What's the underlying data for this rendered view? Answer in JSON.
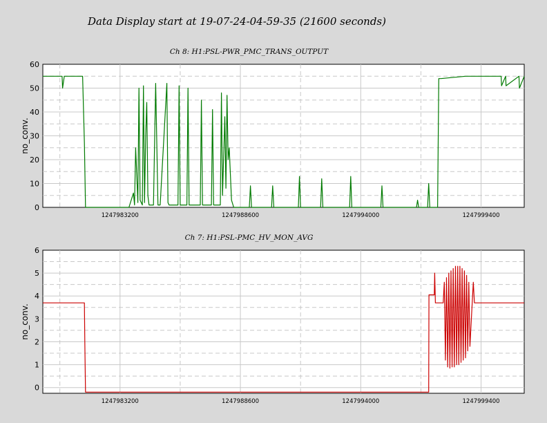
{
  "header": {
    "title": "Data Display start at 19-07-24-04-59-35 (21600 seconds)"
  },
  "colors": {
    "background": "#d9d9d9",
    "plot_bg": "#ffffff",
    "grid": "#c8c8c8",
    "series_ch8": "#007a00",
    "series_ch7": "#cc0000"
  },
  "chart_data": [
    {
      "type": "line",
      "title": "Ch 8: H1:PSL-PWR_PMC_TRANS_OUTPUT",
      "xlabel": "",
      "ylabel": "no_conv.",
      "xlim": [
        1247979735,
        1248001335
      ],
      "ylim": [
        0,
        60
      ],
      "yticks": [
        0,
        10,
        20,
        30,
        40,
        50,
        60
      ],
      "xticks": [
        1247983200,
        1247988600,
        1247994000,
        1247999400
      ],
      "xtick_labels": [
        "1247983200",
        "1247988600",
        "1247994000",
        "1247999400"
      ],
      "grid": true,
      "series": [
        {
          "color": "#007a00",
          "x": [
            1247979735,
            1247980600,
            1247980620,
            1247980700,
            1247981400,
            1247981520,
            1247981600,
            1247981650,
            1247983600,
            1247983800,
            1247983850,
            1247983900,
            1247984000,
            1247984050,
            1247984100,
            1247984200,
            1247984250,
            1247984300,
            1247984350,
            1247984400,
            1247984450,
            1247984500,
            1247984700,
            1247984800,
            1247984900,
            1247985000,
            1247985300,
            1247985350,
            1247985400,
            1247985800,
            1247985850,
            1247985900,
            1247986200,
            1247986250,
            1247986300,
            1247986800,
            1247986850,
            1247986900,
            1247987300,
            1247987350,
            1247987400,
            1247987700,
            1247987750,
            1247987800,
            1247987900,
            1247987950,
            1247988000,
            1247988050,
            1247988100,
            1247988200,
            1247988300,
            1247989000,
            1247989050,
            1247989100,
            1247990000,
            1247990050,
            1247990100,
            1247991200,
            1247991250,
            1247991300,
            1247992200,
            1247992250,
            1247992300,
            1247993500,
            1247993550,
            1247993600,
            1247994900,
            1247994950,
            1247995000,
            1247996500,
            1247996550,
            1247996600,
            1247997000,
            1247997050,
            1247997100,
            1247997450,
            1247997500,
            1247997600,
            1247998700,
            1247998750,
            1248000300,
            1248000320,
            1248000500,
            1248000520,
            1248001100,
            1248001120,
            1248001335
          ],
          "y": [
            55,
            55,
            50,
            55,
            55,
            55,
            27,
            0,
            0,
            6,
            1,
            25,
            2,
            50,
            3,
            1,
            51,
            2,
            30,
            44,
            5,
            1,
            1,
            52,
            1,
            1,
            52,
            2,
            1,
            1,
            51,
            1,
            1,
            50,
            1,
            1,
            45,
            1,
            1,
            41,
            1,
            1,
            48,
            5,
            38,
            8,
            47,
            20,
            25,
            3,
            0,
            0,
            9,
            0,
            0,
            9,
            0,
            0,
            13,
            0,
            0,
            12,
            0,
            0,
            13,
            0,
            0,
            9,
            0,
            0,
            3,
            0,
            0,
            10,
            0,
            0,
            54,
            54,
            55,
            55,
            55,
            51,
            55,
            51,
            55,
            50,
            55
          ]
        }
      ]
    },
    {
      "type": "line",
      "title": "Ch 7: H1:PSL-PMC_HV_MON_AVG",
      "xlabel": "",
      "ylabel": "no_conv.",
      "xlim": [
        1247979735,
        1248001335
      ],
      "ylim": [
        -0.25,
        6
      ],
      "yticks": [
        0,
        1,
        2,
        3,
        4,
        5,
        6
      ],
      "xticks": [
        1247983200,
        1247988600,
        1247994000,
        1247999400
      ],
      "xtick_labels": [
        "1247983200",
        "1247988600",
        "1247994000",
        "1247999400"
      ],
      "grid": true,
      "series": [
        {
          "color": "#cc0000",
          "x": [
            1247979735,
            1247981600,
            1247981620,
            1247981650,
            1247997050,
            1247997060,
            1247997300,
            1247997320,
            1247997350,
            1247997700,
            1247997750,
            1247997800,
            1247997850,
            1247997900,
            1247997950,
            1247998000,
            1247998050,
            1247998100,
            1247998150,
            1247998200,
            1247998250,
            1247998300,
            1247998350,
            1247998400,
            1247998450,
            1247998500,
            1247998550,
            1247998600,
            1247998650,
            1247998700,
            1247998750,
            1247998800,
            1247998850,
            1247998900,
            1247999000,
            1247999050,
            1247999100,
            1248001335
          ],
          "y": [
            3.7,
            3.7,
            2.0,
            -0.2,
            -0.2,
            4.05,
            4.05,
            5.0,
            3.7,
            3.7,
            4.6,
            1.2,
            4.8,
            0.9,
            5.0,
            0.85,
            5.1,
            0.9,
            5.2,
            0.9,
            5.3,
            1.0,
            5.3,
            1.0,
            5.3,
            1.1,
            5.2,
            1.2,
            5.1,
            1.3,
            4.9,
            1.6,
            4.6,
            1.8,
            3.7,
            4.6,
            3.7,
            3.7
          ]
        }
      ]
    }
  ]
}
